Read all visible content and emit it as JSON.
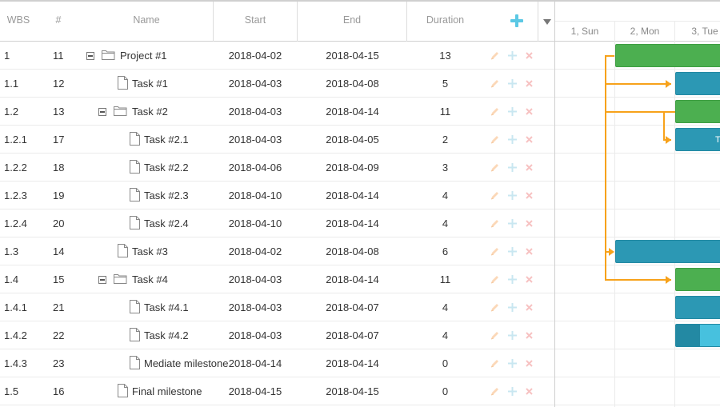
{
  "grid": {
    "columns": {
      "wbs": "WBS",
      "num": "#",
      "name": "Name",
      "start": "Start",
      "end": "End",
      "duration": "Duration"
    },
    "rows": [
      {
        "wbs": "1",
        "num": "11",
        "name": "Project #1",
        "start": "2018-04-02",
        "end": "2018-04-15",
        "duration": "13",
        "type": "project"
      },
      {
        "wbs": "1.1",
        "num": "12",
        "name": "Task #1",
        "start": "2018-04-03",
        "end": "2018-04-08",
        "duration": "5",
        "type": "task"
      },
      {
        "wbs": "1.2",
        "num": "13",
        "name": "Task #2",
        "start": "2018-04-03",
        "end": "2018-04-14",
        "duration": "11",
        "type": "project"
      },
      {
        "wbs": "1.2.1",
        "num": "17",
        "name": "Task #2.1",
        "start": "2018-04-03",
        "end": "2018-04-05",
        "duration": "2",
        "type": "task"
      },
      {
        "wbs": "1.2.2",
        "num": "18",
        "name": "Task #2.2",
        "start": "2018-04-06",
        "end": "2018-04-09",
        "duration": "3",
        "type": "task"
      },
      {
        "wbs": "1.2.3",
        "num": "19",
        "name": "Task #2.3",
        "start": "2018-04-10",
        "end": "2018-04-14",
        "duration": "4",
        "type": "task"
      },
      {
        "wbs": "1.2.4",
        "num": "20",
        "name": "Task #2.4",
        "start": "2018-04-10",
        "end": "2018-04-14",
        "duration": "4",
        "type": "task"
      },
      {
        "wbs": "1.3",
        "num": "14",
        "name": "Task #3",
        "start": "2018-04-02",
        "end": "2018-04-08",
        "duration": "6",
        "type": "task"
      },
      {
        "wbs": "1.4",
        "num": "15",
        "name": "Task #4",
        "start": "2018-04-03",
        "end": "2018-04-14",
        "duration": "11",
        "type": "project"
      },
      {
        "wbs": "1.4.1",
        "num": "21",
        "name": "Task #4.1",
        "start": "2018-04-03",
        "end": "2018-04-07",
        "duration": "4",
        "type": "task"
      },
      {
        "wbs": "1.4.2",
        "num": "22",
        "name": "Task #4.2",
        "start": "2018-04-03",
        "end": "2018-04-07",
        "duration": "4",
        "type": "task"
      },
      {
        "wbs": "1.4.3",
        "num": "23",
        "name": "Mediate milestone",
        "start": "2018-04-14",
        "end": "2018-04-14",
        "duration": "0",
        "type": "milestone"
      },
      {
        "wbs": "1.5",
        "num": "16",
        "name": "Final milestone",
        "start": "2018-04-15",
        "end": "2018-04-15",
        "duration": "0",
        "type": "milestone"
      }
    ]
  },
  "chart": {
    "scale": [
      "1, Sun",
      "2, Mon",
      "3, Tue"
    ],
    "bar_label_task_2_1": "T",
    "colors": {
      "project": "#4caf50",
      "task": "#2c98b4",
      "link": "#f7a21b",
      "add_icon": "#5bc8e4"
    }
  },
  "icons": {
    "toggle": "collapse-minus-icon",
    "folder": "folder-icon",
    "file": "file-icon",
    "edit": "pencil-icon",
    "add": "plus-icon",
    "delete": "close-icon",
    "header_add": "add-task-icon",
    "header_menu": "dropdown-arrow-icon"
  }
}
